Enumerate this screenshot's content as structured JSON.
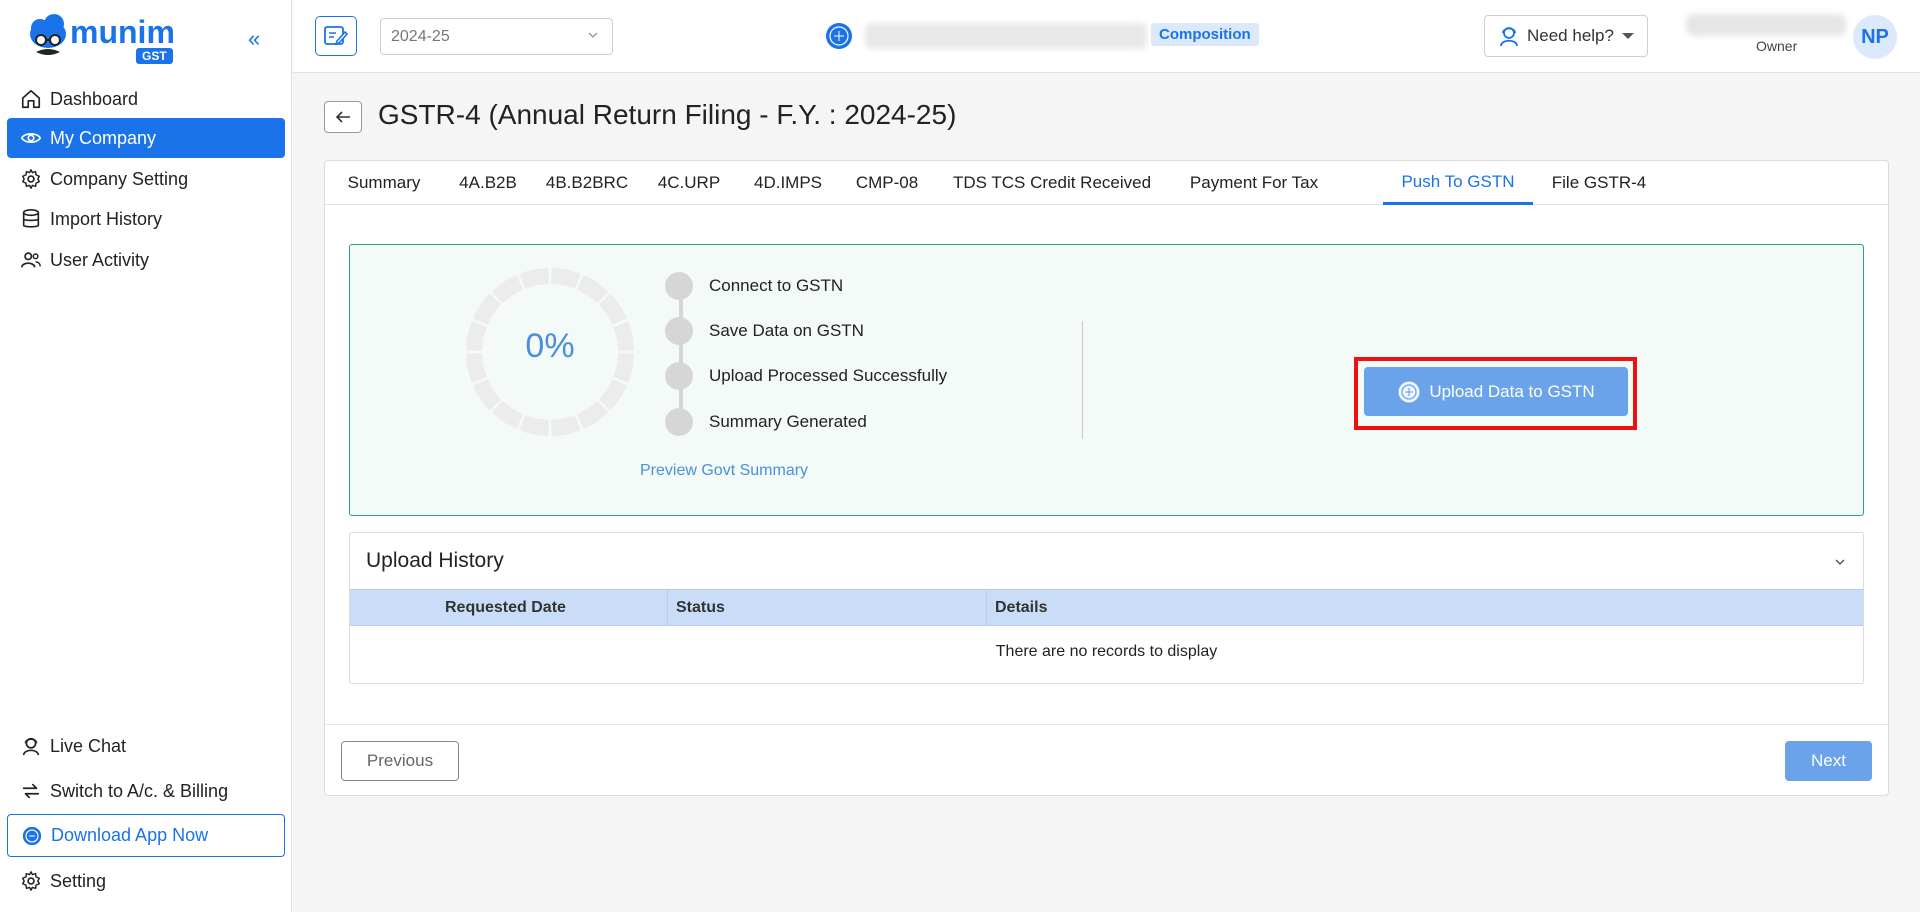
{
  "app": {
    "logo_text": "munim",
    "logo_badge": "GST",
    "collapse_glyph": "«"
  },
  "sidebar": {
    "items": [
      {
        "label": "Dashboard",
        "icon": "home-icon"
      },
      {
        "label": "My Company",
        "icon": "eye-icon",
        "active": true
      },
      {
        "label": "Company Setting",
        "icon": "gear-icon"
      },
      {
        "label": "Import History",
        "icon": "database-icon"
      },
      {
        "label": "User Activity",
        "icon": "users-icon"
      }
    ],
    "bottom_items": [
      {
        "label": "Live Chat",
        "icon": "chat-agent-icon"
      },
      {
        "label": "Switch to A/c. & Billing",
        "icon": "switch-icon"
      },
      {
        "label": "Download App Now",
        "icon": "gst-app-icon"
      },
      {
        "label": "Setting",
        "icon": "gear-icon"
      }
    ]
  },
  "topbar": {
    "fy_selected": "2024-25",
    "scheme_badge": "Composition",
    "help_label": "Need help?",
    "user_role": "Owner",
    "avatar_initials": "NP"
  },
  "page": {
    "title": "GSTR-4 (Annual Return Filing - F.Y. : 2024-25)"
  },
  "tabs": [
    {
      "label": "Summary"
    },
    {
      "label": "4A.B2B"
    },
    {
      "label": "4B.B2BRC"
    },
    {
      "label": "4C.URP"
    },
    {
      "label": "4D.IMPS"
    },
    {
      "label": "CMP-08"
    },
    {
      "label": "TDS TCS Credit Received"
    },
    {
      "label": "Payment For Tax"
    },
    {
      "label": "Push To GSTN",
      "active": true
    },
    {
      "label": "File GSTR-4"
    }
  ],
  "push": {
    "progress_percent": 0,
    "progress_text": "0%",
    "steps": [
      "Connect to GSTN",
      "Save Data on GSTN",
      "Upload Processed Successfully",
      "Summary Generated"
    ],
    "preview_link": "Preview Govt Summary",
    "upload_button": "Upload Data to GSTN"
  },
  "history": {
    "title": "Upload History",
    "columns": [
      "Requested Date",
      "Status",
      "Details"
    ],
    "empty_text": "There are no records to display"
  },
  "footer": {
    "previous_label": "Previous",
    "next_label": "Next"
  },
  "colors": {
    "primary": "#1a73e8",
    "primary_light": "#6aa3ea",
    "panel_border": "#28a96b",
    "highlight": "#ee1111"
  }
}
